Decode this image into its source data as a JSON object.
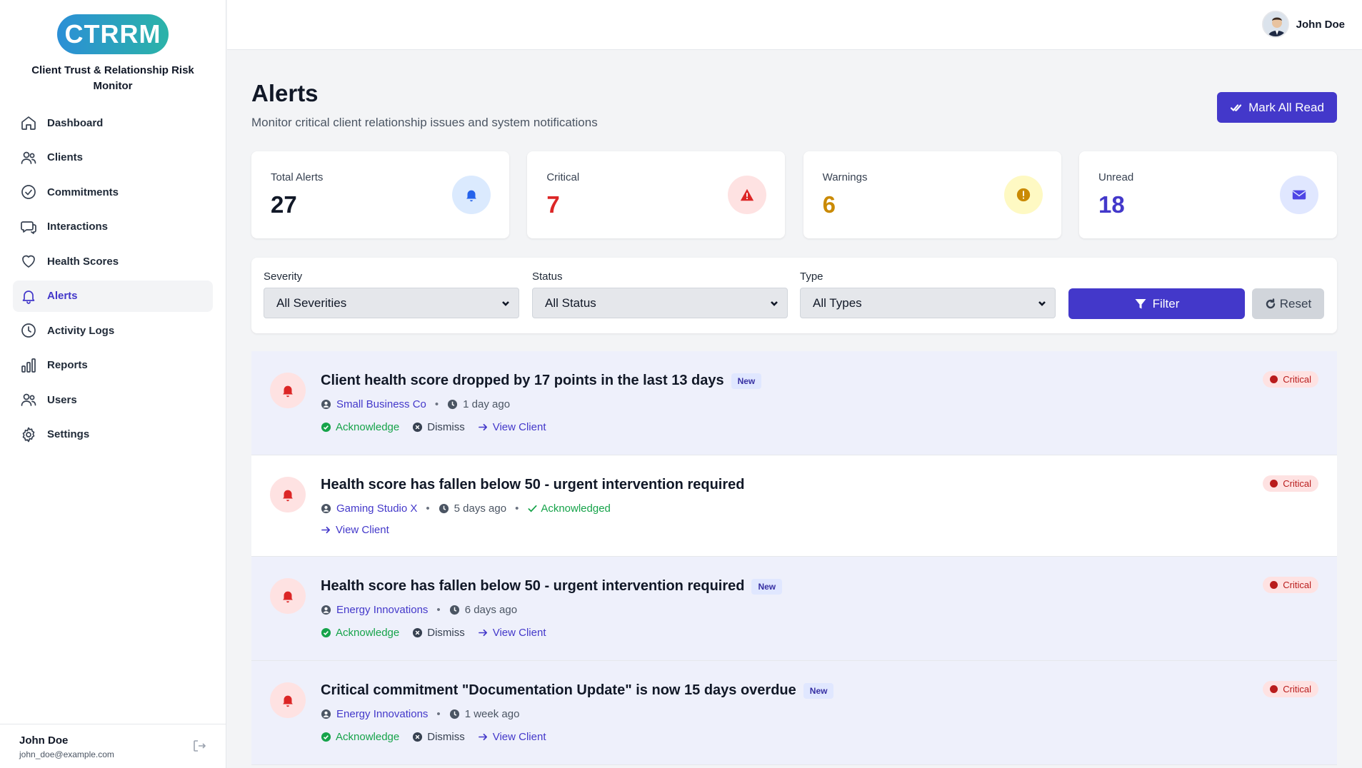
{
  "brand": {
    "logo_text": "CTRRM",
    "name": "Client Trust & Relationship Risk Monitor"
  },
  "sidebar": {
    "items": [
      {
        "label": "Dashboard",
        "icon": "home-icon"
      },
      {
        "label": "Clients",
        "icon": "users-icon"
      },
      {
        "label": "Commitments",
        "icon": "check-circle-icon"
      },
      {
        "label": "Interactions",
        "icon": "chat-icon"
      },
      {
        "label": "Health Scores",
        "icon": "heart-icon"
      },
      {
        "label": "Alerts",
        "icon": "bell-icon",
        "active": true
      },
      {
        "label": "Activity Logs",
        "icon": "clock-icon"
      },
      {
        "label": "Reports",
        "icon": "bar-chart-icon"
      },
      {
        "label": "Users",
        "icon": "users-icon"
      },
      {
        "label": "Settings",
        "icon": "gear-icon"
      }
    ],
    "footer": {
      "name": "John Doe",
      "email": "john_doe@example.com"
    }
  },
  "topbar": {
    "user_name": "John Doe"
  },
  "page": {
    "title": "Alerts",
    "subtitle": "Monitor critical client relationship issues and system notifications",
    "mark_all_label": "Mark All Read"
  },
  "stats": [
    {
      "label": "Total Alerts",
      "value": "27",
      "color": "#111827",
      "icon": "bell-icon",
      "icon_bg": "#dbeafe",
      "icon_color": "#2563eb"
    },
    {
      "label": "Critical",
      "value": "7",
      "color": "#dc2626",
      "icon": "warning-triangle-icon",
      "icon_bg": "#fee2e2",
      "icon_color": "#dc2626"
    },
    {
      "label": "Warnings",
      "value": "6",
      "color": "#ca8a04",
      "icon": "exclamation-circle-icon",
      "icon_bg": "#fef9c3",
      "icon_color": "#ca8a04"
    },
    {
      "label": "Unread",
      "value": "18",
      "color": "#4338ca",
      "icon": "envelope-icon",
      "icon_bg": "#e0e7ff",
      "icon_color": "#4f46e5"
    }
  ],
  "filters": {
    "severity": {
      "label": "Severity",
      "value": "All Severities"
    },
    "status": {
      "label": "Status",
      "value": "All Status"
    },
    "type": {
      "label": "Type",
      "value": "All Types"
    },
    "filter_label": "Filter",
    "reset_label": "Reset"
  },
  "alerts": [
    {
      "title": "Client health score dropped by 17 points in the last 13 days",
      "badge": "New",
      "client": "Small Business Co",
      "time": "1 day ago",
      "severity": "Critical",
      "unread": true,
      "acknowledged": false
    },
    {
      "title": "Health score has fallen below 50 - urgent intervention required",
      "badge": "",
      "client": "Gaming Studio X",
      "time": "5 days ago",
      "status_text": "Acknowledged",
      "severity": "Critical",
      "unread": false,
      "acknowledged": true
    },
    {
      "title": "Health score has fallen below 50 - urgent intervention required",
      "badge": "New",
      "client": "Energy Innovations",
      "time": "6 days ago",
      "severity": "Critical",
      "unread": true,
      "acknowledged": false
    },
    {
      "title": "Critical commitment \"Documentation Update\" is now 15 days overdue",
      "badge": "New",
      "client": "Energy Innovations",
      "time": "1 week ago",
      "severity": "Critical",
      "unread": true,
      "acknowledged": false
    }
  ],
  "actions": {
    "acknowledge": "Acknowledge",
    "dismiss": "Dismiss",
    "view_client": "View Client"
  }
}
